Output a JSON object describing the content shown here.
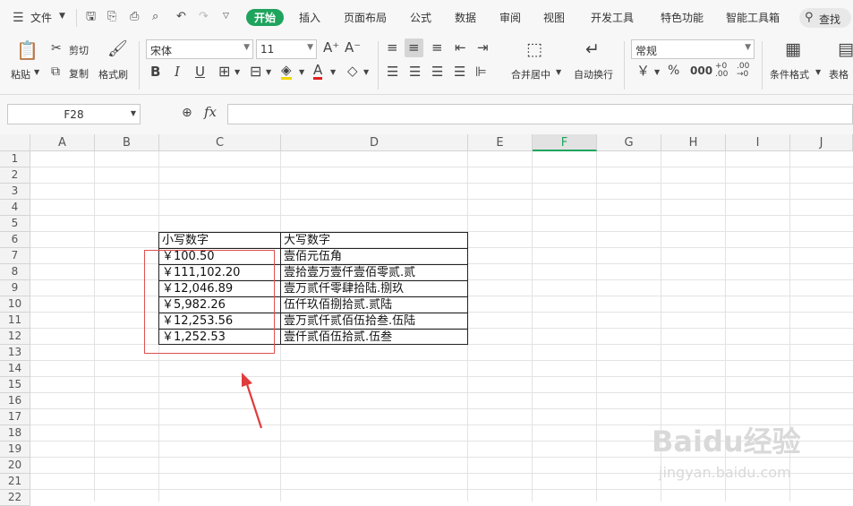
{
  "menu": {
    "file": "文件",
    "tabs": [
      "开始",
      "插入",
      "页面布局",
      "公式",
      "数据",
      "审阅",
      "视图",
      "开发工具",
      "特色功能",
      "智能工具箱"
    ],
    "search": "查找"
  },
  "ribbon": {
    "paste": "粘贴",
    "cut": "剪切",
    "copy": "复制",
    "format_painter": "格式刷",
    "font_name": "宋体",
    "font_size": "11",
    "merge_center": "合并居中",
    "wrap_text": "自动换行",
    "number_format": "常规",
    "conditional_format": "条件格式",
    "table_style": "表格"
  },
  "formula_bar": {
    "name_box": "F28",
    "fx": "fx",
    "value": ""
  },
  "sheet": {
    "columns": [
      "A",
      "B",
      "C",
      "D",
      "E",
      "F",
      "G",
      "H",
      "I",
      "J"
    ],
    "selected_column": "F",
    "rows": [
      "1",
      "2",
      "3",
      "4",
      "5",
      "6",
      "7",
      "8",
      "9",
      "10",
      "11",
      "12",
      "13",
      "14",
      "15",
      "16",
      "17",
      "18",
      "19",
      "20",
      "21",
      "22"
    ],
    "table_header": {
      "c": "小写数字",
      "d": "大写数字"
    },
    "table_rows": [
      {
        "c": "￥100.50",
        "d": "壹佰元伍角"
      },
      {
        "c": "￥111,102.20",
        "d": "壹拾壹万壹仟壹佰零贰.贰"
      },
      {
        "c": "￥12,046.89",
        "d": "壹万贰仟零肆拾陆.捌玖"
      },
      {
        "c": "￥5,982.26",
        "d": "伍仟玖佰捌拾贰.贰陆"
      },
      {
        "c": "￥12,253.56",
        "d": "壹万贰仟贰佰伍拾叁.伍陆"
      },
      {
        "c": "￥1,252.53",
        "d": "壹仟贰佰伍拾贰.伍叁"
      }
    ]
  },
  "watermark": {
    "logo": "Baidu经验",
    "url": "jingyan.baidu.com"
  },
  "colors": {
    "accent": "#1fa45e",
    "annotation": "#e03c3c"
  }
}
